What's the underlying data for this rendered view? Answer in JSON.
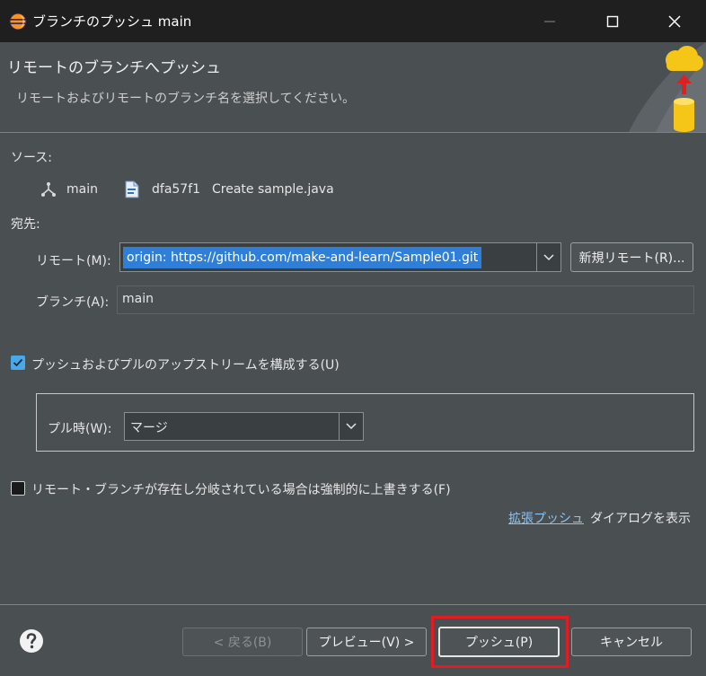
{
  "window": {
    "title": "ブランチのプッシュ main"
  },
  "banner": {
    "title": "リモートのブランチへプッシュ",
    "description": "リモートおよびリモートのブランチ名を選択してください。"
  },
  "source": {
    "label": "ソース:",
    "branch": "main",
    "commit_id": "dfa57f1",
    "commit_message": "Create sample.java"
  },
  "destination": {
    "label": "宛先:",
    "remote_label": "リモート(M):",
    "remote_value": "origin: https://github.com/make-and-learn/Sample01.git",
    "new_remote_button": "新規リモート(R)...",
    "branch_label": "ブランチ(A):",
    "branch_value": "main"
  },
  "upstream": {
    "checkbox_label": "プッシュおよびプルのアップストリームを構成する(U)",
    "checked": true,
    "pull_label": "プル時(W):",
    "pull_value": "マージ"
  },
  "force": {
    "checkbox_label": "リモート・ブランチが存在し分岐されている場合は強制的に上書きする(F)",
    "checked": false
  },
  "advanced": {
    "link": "拡張プッシュ",
    "suffix": "ダイアログを表示"
  },
  "buttons": {
    "back": "< 戻る(B)",
    "preview": "プレビュー(V) >",
    "push": "プッシュ(P)",
    "cancel": "キャンセル"
  },
  "colors": {
    "checkbox_checked": "#4aa8e8",
    "selection": "#2f7fd8",
    "highlight_box": "#e31b23"
  }
}
